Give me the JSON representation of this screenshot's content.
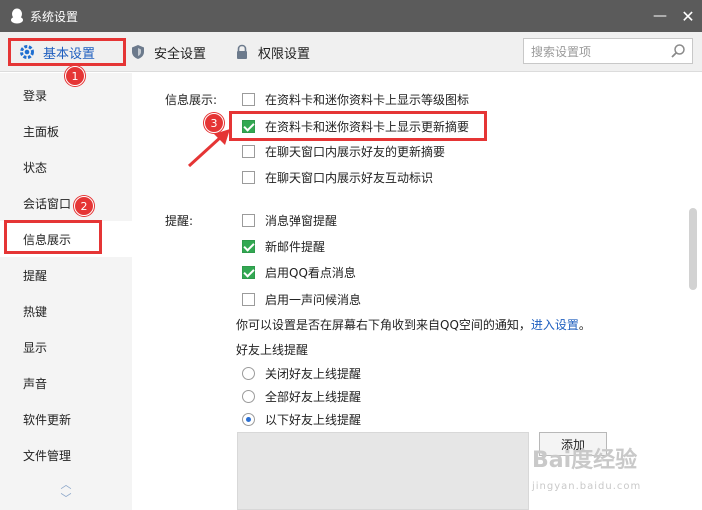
{
  "window": {
    "title": "系统设置"
  },
  "tabs": [
    {
      "label": "基本设置"
    },
    {
      "label": "安全设置"
    },
    {
      "label": "权限设置"
    }
  ],
  "search": {
    "placeholder": "搜索设置项"
  },
  "sidebar": {
    "items": [
      {
        "label": "登录"
      },
      {
        "label": "主面板"
      },
      {
        "label": "状态"
      },
      {
        "label": "会话窗口"
      },
      {
        "label": "信息展示"
      },
      {
        "label": "提醒"
      },
      {
        "label": "热键"
      },
      {
        "label": "显示"
      },
      {
        "label": "声音"
      },
      {
        "label": "软件更新"
      },
      {
        "label": "文件管理"
      }
    ]
  },
  "info_display": {
    "label": "信息展示:",
    "options": [
      {
        "label": "在资料卡和迷你资料卡上显示等级图标",
        "checked": false
      },
      {
        "label": "在资料卡和迷你资料卡上显示更新摘要",
        "checked": true
      },
      {
        "label": "在聊天窗口内展示好友的更新摘要",
        "checked": false
      },
      {
        "label": "在聊天窗口内展示好友互动标识",
        "checked": false
      }
    ]
  },
  "reminder": {
    "label": "提醒:",
    "options": [
      {
        "label": "消息弹窗提醒",
        "checked": false
      },
      {
        "label": "新邮件提醒",
        "checked": true
      },
      {
        "label": "启用QQ看点消息",
        "checked": true
      },
      {
        "label": "启用一声问候消息",
        "checked": false
      }
    ],
    "note_text": "你可以设置是否在屏幕右下角收到来自QQ空间的通知，",
    "note_link": "进入设置",
    "note_end": "。"
  },
  "friend_online": {
    "label": "好友上线提醒",
    "options": [
      {
        "label": "关闭好友上线提醒",
        "selected": false
      },
      {
        "label": "全部好友上线提醒",
        "selected": false
      },
      {
        "label": "以下好友上线提醒",
        "selected": true
      }
    ],
    "add_button": "添加"
  },
  "annotations": {
    "badge1": "1",
    "badge2": "2",
    "badge3": "3"
  },
  "watermark": {
    "brand": "Bai度经验",
    "url": "jingyan.baidu.com"
  },
  "colors": {
    "highlight_red": "#e53535",
    "check_green": "#32a852",
    "link_blue": "#1f5fbf",
    "titlebar": "#5b5b5b"
  }
}
